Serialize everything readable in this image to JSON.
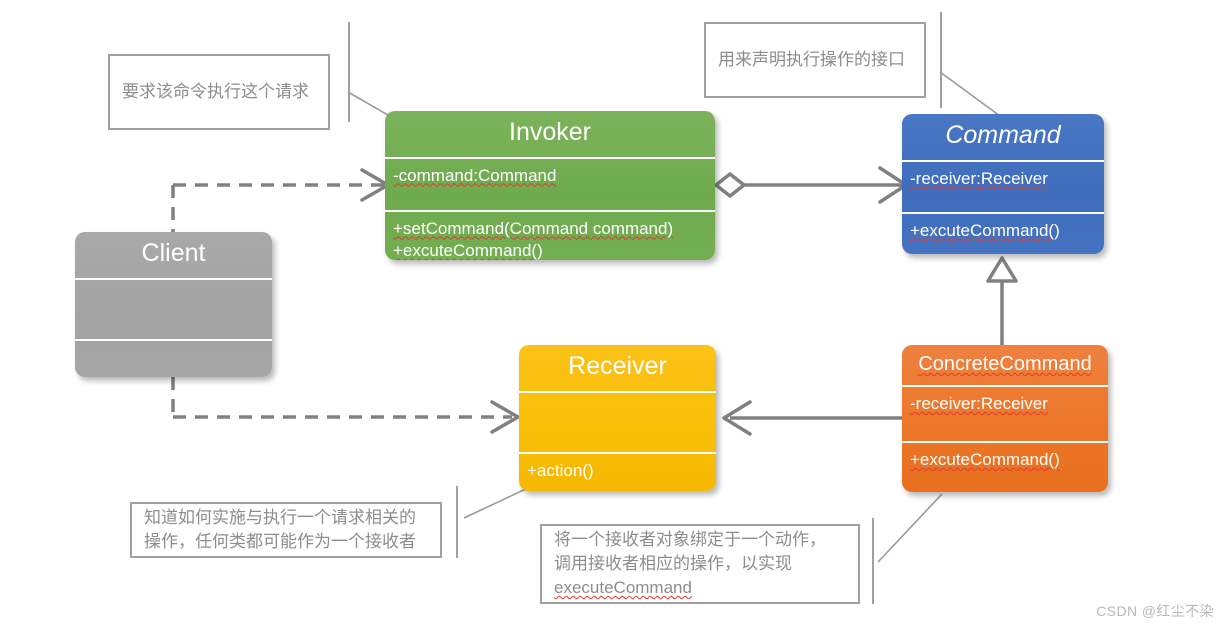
{
  "diagram": {
    "title": "Command Pattern UML Class Diagram",
    "colors": {
      "invoker": "#6faa4e",
      "command": "#3f6dbd",
      "client": "#a3a3a3",
      "receiver": "#f9bf09",
      "concrete_command": "#ec7728",
      "line": "#808080",
      "note_border": "#a0a0a0",
      "note_text": "#8d8d8d",
      "spellcheck": "#e03b2f"
    },
    "classes": {
      "invoker": {
        "name": "Invoker",
        "attributes": [
          "-command:Command"
        ],
        "methods": [
          "+setCommand(Command command)",
          "+excuteCommand()"
        ]
      },
      "command": {
        "name": "Command",
        "abstract": true,
        "attributes": [
          "-receiver:Receiver"
        ],
        "methods": [
          "+excuteCommand()"
        ]
      },
      "client": {
        "name": "Client",
        "attributes": [],
        "methods": []
      },
      "receiver": {
        "name": "Receiver",
        "attributes": [],
        "methods": [
          "+action()"
        ]
      },
      "concrete_command": {
        "name": "ConcreteCommand",
        "attributes": [
          "-receiver:Receiver"
        ],
        "methods": [
          "+excuteCommand()"
        ]
      }
    },
    "notes": {
      "invoker_note": {
        "lines": [
          "要求该命令执行这个请求"
        ]
      },
      "command_note": {
        "lines": [
          "用来声明执行操作的接口"
        ]
      },
      "receiver_note": {
        "lines": [
          "知道如何实施与执行一个请求相关的",
          "操作，任何类都可能作为一个接收者"
        ]
      },
      "concrete_command_note": {
        "lines": [
          "将一个接收者对象绑定于一个动作，",
          "调用接收者相应的操作，以实现"
        ],
        "underlined_line": "executeCommand"
      }
    },
    "relations": [
      {
        "name": "client-to-invoker",
        "type": "dependency",
        "from": "Client",
        "to": "Invoker",
        "style": "dashed-open-arrow"
      },
      {
        "name": "client-to-receiver",
        "type": "dependency",
        "from": "Client",
        "to": "Receiver",
        "style": "dashed-open-arrow"
      },
      {
        "name": "invoker-to-command",
        "type": "aggregation",
        "from": "Invoker",
        "to": "Command",
        "style": "hollow-diamond-open-arrow"
      },
      {
        "name": "concretecommand-to-command",
        "type": "generalization",
        "from": "ConcreteCommand",
        "to": "Command",
        "style": "hollow-triangle"
      },
      {
        "name": "concretecommand-to-receiver",
        "type": "association",
        "from": "ConcreteCommand",
        "to": "Receiver",
        "style": "solid-open-arrow"
      }
    ]
  },
  "watermark": {
    "text": "CSDN @红尘不染"
  }
}
